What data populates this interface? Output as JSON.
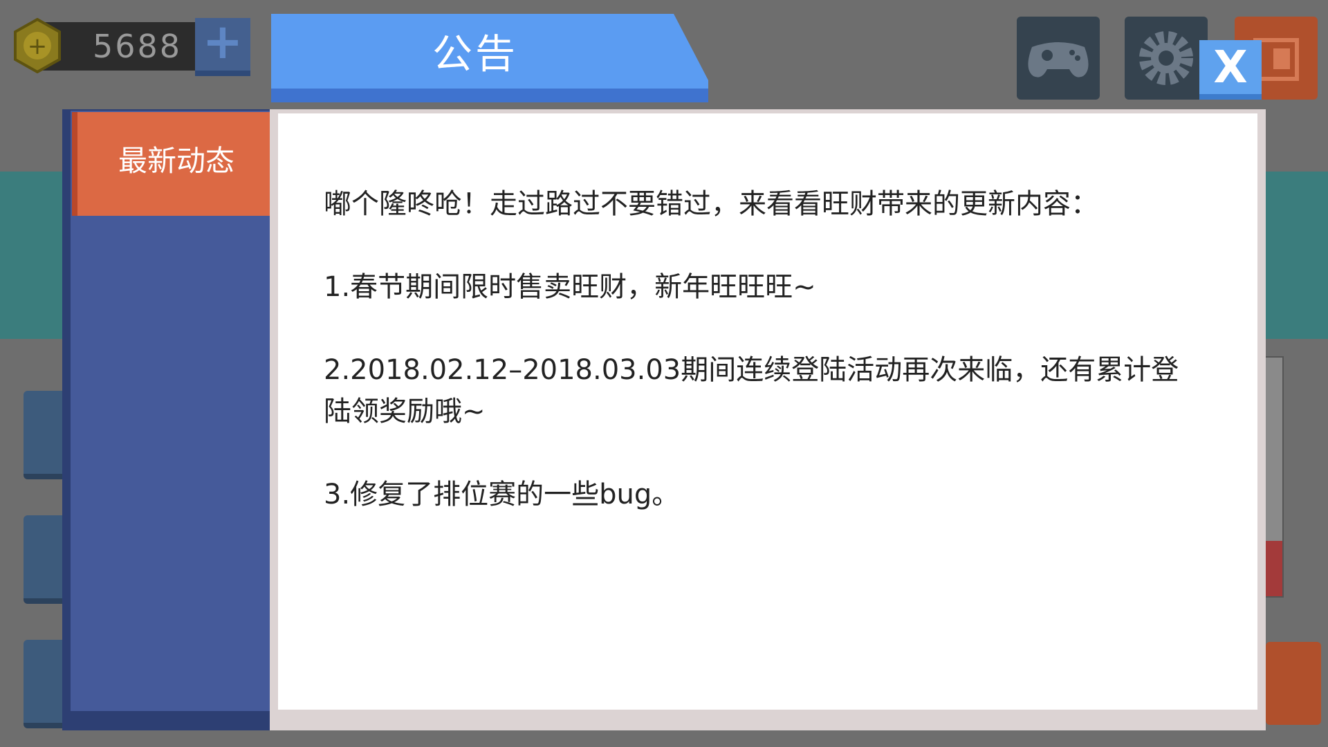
{
  "hud": {
    "coins": "5688",
    "add_label": "+"
  },
  "dialog": {
    "title": "公告",
    "close_label": "X",
    "tabs": [
      {
        "label": "最新动态",
        "active": true
      }
    ],
    "content_lines": [
      "嘟个隆咚呛！走过路过不要错过，来看看旺财带来的更新内容：",
      "1.春节期间限时售卖旺财，新年旺旺旺~",
      "2.2018.02.12–2018.03.03期间连续登陆活动再次来临，还有累计登陆领奖励哦~",
      "3.修复了排位赛的一些bug。"
    ]
  },
  "colors": {
    "title_blue": "#5b9cf2",
    "tab_orange": "#dc6944",
    "panel_blue": "#455a9a",
    "close_blue": "#5fa2ee"
  }
}
